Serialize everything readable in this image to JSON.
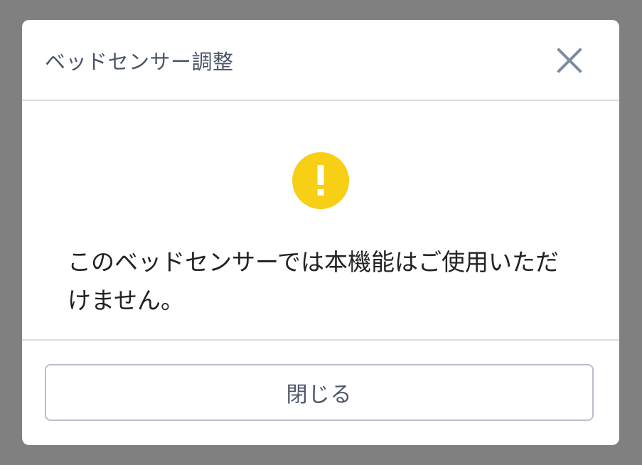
{
  "dialog": {
    "title": "ベッドセンサー調整",
    "close_icon": "close-icon",
    "warning_icon": "exclamation-circle-icon",
    "warning_color": "#f7cf14",
    "message": "このベッドセンサーでは本機能はご使用いただけません。",
    "close_button_label": "閉じる"
  }
}
